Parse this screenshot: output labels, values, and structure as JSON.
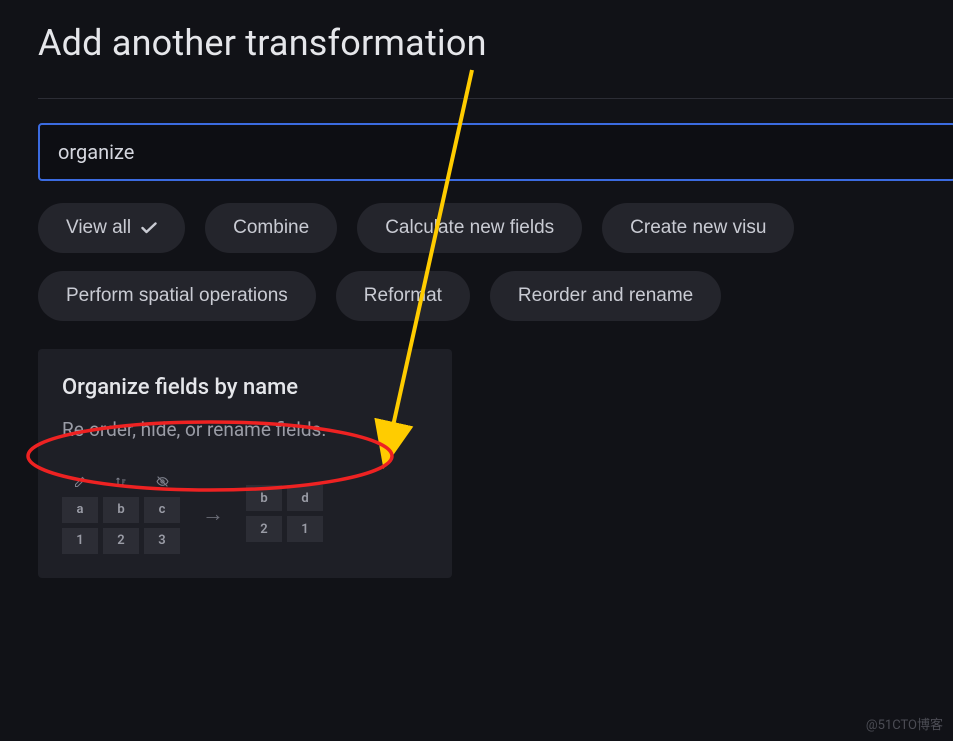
{
  "title": "Add another transformation",
  "search": {
    "value": "organize"
  },
  "chips_row1": [
    {
      "label": "View all",
      "checked": true
    },
    {
      "label": "Combine",
      "checked": false
    },
    {
      "label": "Calculate new fields",
      "checked": false
    },
    {
      "label": "Create new visu",
      "checked": false
    }
  ],
  "chips_row2": [
    {
      "label": "Perform spatial operations",
      "checked": false
    },
    {
      "label": "Reformat",
      "checked": false
    },
    {
      "label": "Reorder and rename",
      "checked": false
    }
  ],
  "card": {
    "title": "Organize fields by name",
    "desc": "Re-order, hide, or rename fields.",
    "left_headers": [
      "a",
      "b",
      "c"
    ],
    "left_values": [
      "1",
      "2",
      "3"
    ],
    "right_headers": [
      "b",
      "d"
    ],
    "right_values": [
      "2",
      "1"
    ]
  },
  "watermark": "@51CTO博客"
}
